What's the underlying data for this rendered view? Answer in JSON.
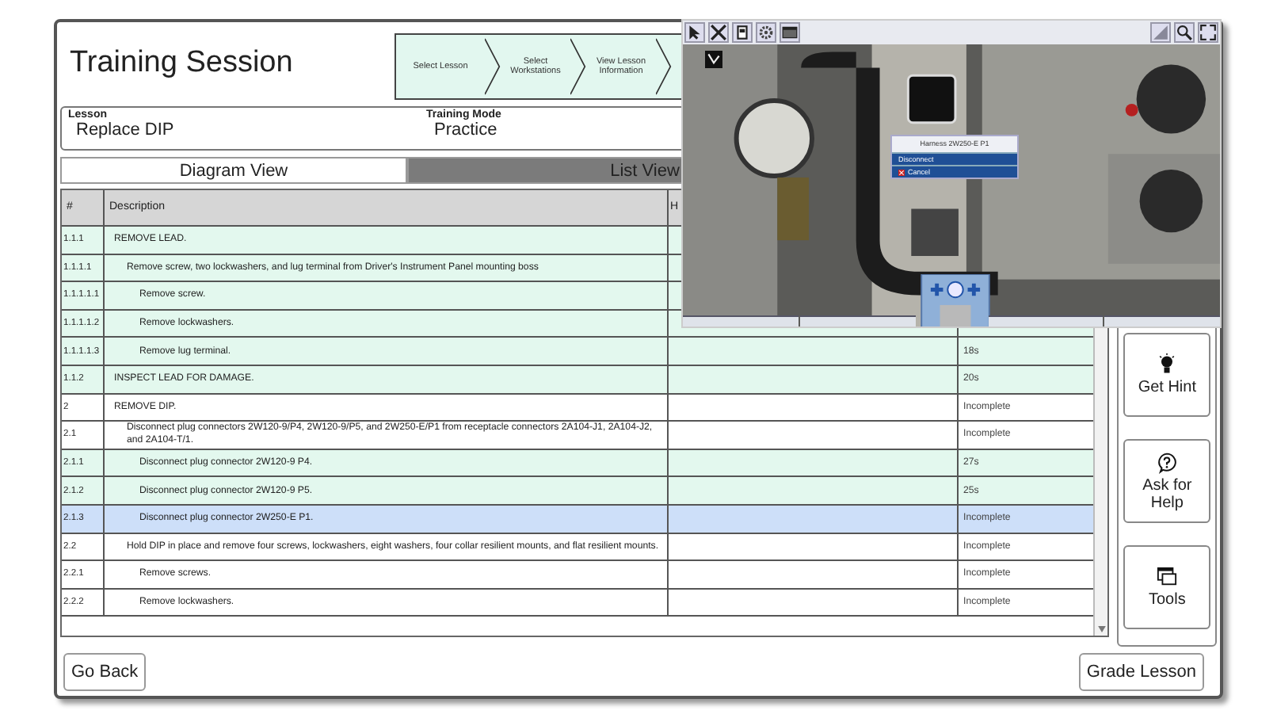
{
  "window": {
    "title": "Training Session"
  },
  "steps": [
    {
      "label": "Select Lesson"
    },
    {
      "label": "Select Workstations"
    },
    {
      "label": "View Lesson Information"
    }
  ],
  "lesson": {
    "label": "Lesson",
    "value": "Replace DIP"
  },
  "training_mode": {
    "label": "Training Mode",
    "value": "Practice"
  },
  "tabs": [
    {
      "label": "Diagram View",
      "selected": false
    },
    {
      "label": "List View",
      "selected": true
    }
  ],
  "table": {
    "columns": [
      "#",
      "Description",
      "H"
    ],
    "rows": [
      {
        "num": "1.1.1",
        "text": "REMOVE LEAD.",
        "done": true,
        "selected": false,
        "children": [
          {
            "num": "1.1.1.1",
            "text": "Remove screw, two lockwashers, and lug terminal from Driver's Instrument Panel mounting boss",
            "done": true,
            "selected": false,
            "children": [
              {
                "num": "1.1.1.1.1",
                "text": "Remove screw.",
                "done": true,
                "selected": false
              },
              {
                "num": "1.1.1.1.2",
                "text": "Remove lockwashers.",
                "done": true,
                "selected": false
              },
              {
                "num": "1.1.1.1.3",
                "text": "Remove lug terminal.",
                "status": "18s",
                "done": true,
                "selected": false
              }
            ]
          }
        ]
      },
      {
        "num": "1.1.2",
        "text": "INSPECT LEAD FOR DAMAGE.",
        "status": "20s",
        "done": true,
        "selected": false
      },
      {
        "num": "2",
        "text": "REMOVE DIP.",
        "status": "Incomplete",
        "done": false,
        "selected": false,
        "children": [
          {
            "num": "2.1",
            "text": "Disconnect plug connectors 2W120-9/P4, 2W120-9/P5, and 2W250-E/P1 from receptacle connectors 2A104-J1, 2A104-J2, and 2A104-T/1.",
            "status": "Incomplete",
            "done": false,
            "selected": false,
            "children": [
              {
                "num": "2.1.1",
                "text": "Disconnect plug connector 2W120-9 P4.",
                "status": "27s",
                "done": true,
                "selected": false
              },
              {
                "num": "2.1.2",
                "text": "Disconnect plug connector 2W120-9 P5.",
                "status": "25s",
                "done": true,
                "selected": false
              },
              {
                "num": "2.1.3",
                "text": "Disconnect plug connector 2W250-E P1.",
                "status": "Incomplete",
                "done": false,
                "selected": true
              }
            ]
          },
          {
            "num": "2.2",
            "text": "Hold DIP in place and remove four screws, lockwashers, eight washers, four collar resilient mounts, and flat resilient mounts.",
            "status": "Incomplete",
            "done": false,
            "selected": false,
            "children": [
              {
                "num": "2.2.1",
                "text": "Remove screws.",
                "status": "Incomplete",
                "done": false,
                "selected": false
              },
              {
                "num": "2.2.2",
                "text": "Remove lockwashers.",
                "status": "Incomplete",
                "done": false,
                "selected": false
              }
            ]
          }
        ]
      }
    ]
  },
  "side_buttons": [
    {
      "label": "Get Hint",
      "kind": "hint"
    },
    {
      "label": "Ask for Help",
      "kind": "help"
    },
    {
      "label": "Tools",
      "kind": "tools"
    }
  ],
  "footer": {
    "back": "Go Back",
    "grade": "Grade Lesson"
  },
  "simulator": {
    "menu": {
      "title": "Harness 2W250-E P1",
      "items": [
        {
          "label": "Disconnect",
          "kind": "action"
        },
        {
          "label": "Cancel",
          "kind": "cancel"
        }
      ]
    }
  }
}
